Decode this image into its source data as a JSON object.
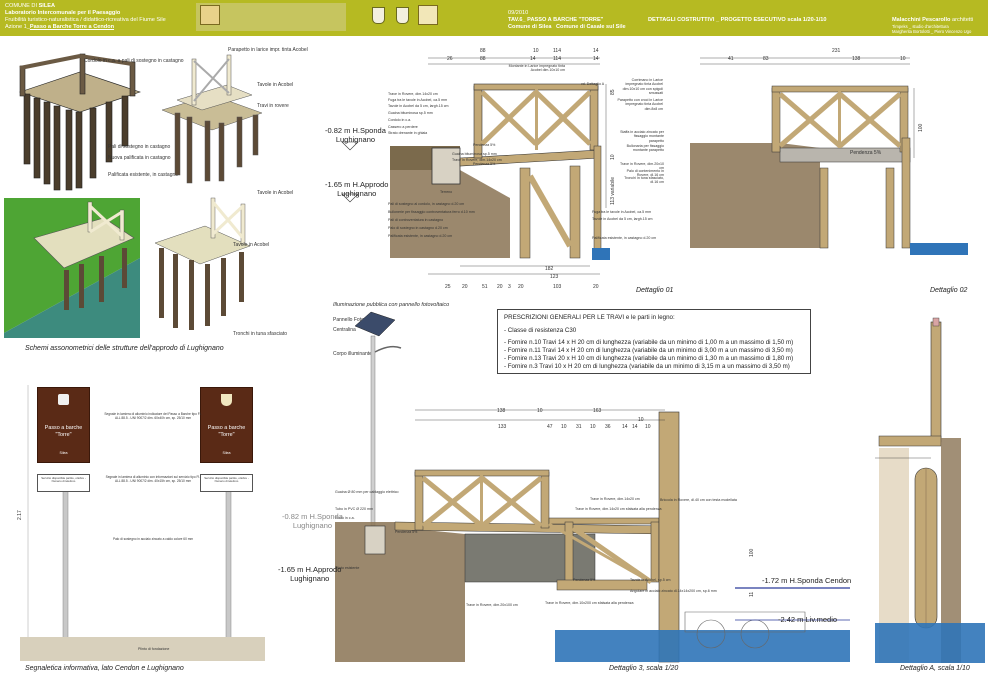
{
  "header": {
    "comune_prefix": "COMUNE DI",
    "comune_name": "SILEA",
    "lab": "Laboratorio Intercomunale per il Paesaggio",
    "fruibilita": "Fruibilità turistico-naturalistica / didattico-ricreativa del Fiume Sile",
    "azione_prefix": "Azione 1_",
    "azione_name": "Passo a Barche Torre a Cendon",
    "date": "09/2010",
    "tavola": "TAV.6_ PASSO A BARCHE \"TORRE\"",
    "comune1": "Comune di Silea",
    "comune2": "Comune di Casale sul Sile",
    "dettagli": "DETTAGLI COSTRUTTIVI _ PROGETTO ESECUTIVO scala 1/20-1/10",
    "architects": "Malacchini Pescarollo",
    "architects_suffix": "architetti",
    "team1": "Timpeks _ studio d'architettura",
    "team2": "Margherita Bortolotti _ Piero Vincenzo Ugo",
    "colors": {
      "band": "#b6ba22",
      "wood": "#c2a876",
      "water": "#2f74b8",
      "ground": "#7a6548"
    }
  },
  "captions": {
    "schemi": "Schemi assonometrici delle strutture dell'approdo di Lughignano",
    "segnaletica": "Segnaletica informativa, lato Cendon e Lughignano",
    "dettaglio01": "Dettaglio 01",
    "dettaglio02": "Dettaglio 02",
    "dettaglio3": "Dettaglio 3, scala 1/20",
    "dettaglioA": "Dettaglio A, scala 1/10"
  },
  "iso_labels": {
    "corrimano": "Cordolo in c.a. a pali di sostegno in castagno",
    "pali": "Pali di sostegno in castagno",
    "nuova": "Nuova palificata in castagno",
    "palificata": "Palificata esistente, in castagno",
    "parapetto": "Parapetto in larice impr. tinta Acobel",
    "tavole": "Tavole in Acobel",
    "travi": "Travi in rovere",
    "tavole2": "Tavole in Acobel",
    "tronchi": "Tronchi in tuna sfasciato"
  },
  "levels": {
    "sponda1": "-0.82 m H.Sponda",
    "sponda1b": "Lughignano",
    "approdo1": "-1.65 m H.Approdo",
    "approdo1b": "Lughignano",
    "sponda2": "-0.82 m H.Sponda",
    "sponda2b": "Lughignano",
    "approdo2": "-1.65 m H.Approdo",
    "approdo2b": "Lughignano",
    "cendon": "-1.72 m H.Sponda Cendon",
    "liv_medio": "-2.42 m Liv.medio"
  },
  "dims_d01": {
    "top": [
      "88",
      "10",
      "114",
      "14",
      "26",
      "88",
      "14",
      "114",
      "14"
    ],
    "bottom": [
      "182",
      "123",
      "25",
      "20",
      "51",
      "20",
      "3",
      "20",
      "103",
      "20"
    ],
    "side": [
      "85",
      "10",
      "113 variabile"
    ]
  },
  "dims_d02": {
    "top": [
      "231",
      "41",
      "83",
      "138",
      "10"
    ],
    "side": [
      "100"
    ]
  },
  "dims_d3": {
    "top": [
      "138",
      "10",
      "163",
      "10",
      "133",
      "47",
      "10",
      "31",
      "10",
      "36",
      "14",
      "14",
      "10"
    ],
    "side": [
      "100",
      "11"
    ]
  },
  "d01_labels": [
    "Montante in Larice impregnato tinta Acobel dim.10x10 cm",
    "vd. Dettaglio A",
    "Corrimano in Larice impregnato tinta Acobel dim.10x10 cm con spigoli smussati",
    "Parapetto con croci in Larice impregnato tinta Acobel dim.8x8 cm",
    "Staffa in acciaio zincato per fissaggio montante parapetto",
    "Bullonaria per fissaggio montante parapetto",
    "Trave in Rovere, dim.20x10 cm",
    "Palo di contenimento in Rovere, dl.16 cm",
    "Tronchi in tuna sfasciato, dl.16 cm",
    "Trave in Rovere, dim.14x20 cm",
    "Fuga tra le tavole in Acobel, ca.5 mm",
    "Tavole in Acobel da 5 cm, largh.15 cm",
    "Guaina bituminosa sp.5 mm",
    "Cordolo in c.a.",
    "Cassero a perdere",
    "Strato drenante in ghiaia",
    "Pendenza 5%",
    "Guaina bituminosa sp.5 mm",
    "Trave in Rovere, dim.14x20 cm",
    "Pendenza 5%",
    "Pali di sostegno al cordolo, in castagno d.20 cm",
    "Bullonerie per fissaggio controventatura ferro d.10 mm",
    "Pali di controventatura in castagno",
    "Palo di sostegno in castagno d.20 cm",
    "Palificata esistente, in castagno d.20 cm",
    "Fuga tra le tavole in Acobel, ca.5 mm",
    "Tavole in Acobel da 5 cm, largh.15 cm",
    "Terreno",
    "Palificata esistente, in castagno d.20 cm"
  ],
  "d02_labels": [
    "Pendenza 5%"
  ],
  "presc": {
    "title": "PRESCRIZIONI GENERALI PER LE TRAVI e le parti in legno:",
    "classe": "- Classe di resistenza C30",
    "r1": "- Fornire n.10 Travi 14 x H 20 cm  di lunghezza (variabile da un minimo di 1,00 m a un massimo di 1,50 m)",
    "r2": "- Fornire n.11 Travi 14 x H 20 cm  di lunghezza (variabile da un minimo di 3,00 m a un massimo di 3,50 m)",
    "r3": "- Fornire n.13 Travi 20 x H 10 cm  di lunghezza (variabile da un minimo di 1,30 m a un massimo di 1,80 m)",
    "r4": "- Fornire n.3   Travi 10 x H 20 cm  di lunghezza (variabile da un minimo di  3,15 m a un massimo di 3,50 m)"
  },
  "lamp": {
    "title": "Illuminazione pubblica con pannello fotovoltaico",
    "pannello": "Pannello Fotovoltaico",
    "centralina": "Centralina",
    "corpo": "Corpo illuminante"
  },
  "d3_labels": [
    "Guaina Ø 80 mm per cablaggio elettrico",
    "Tubo in PVC Ø 220 mm",
    "Plinto in c.a.",
    "Pendenza 5%",
    "Plinto esistente",
    "Briccola in Rovere, dl.40 cm con testa modellata",
    "Trave in Rovere, dim.14x20 cm",
    "Trave in Rovere, dim.14x20 cm sfalsata alla pendenza",
    "Pendenza 5%",
    "Tavole in Acobel, sp.5 cm",
    "Angolare in acciaio zincato dl.14x14x200 cm, sp.6 mm",
    "Trave in Rovere, dim.20x100 cm",
    "Trave in Rovere, dim.10x200 cm sfalsata alla pendenza"
  ],
  "sign": {
    "title1": "Passo a barche",
    "title2": "\"Torre\"",
    "small": "Silea",
    "plate": "Servizio disponibile partire, ottobre - Numero di telefono",
    "label1": "Segnale in lamiera di alluminio indicatore del Passo a Barche tipo FI-ALL 88.5 - UNI 9007/2 dim. 60x40h cm, sp. 25/10 mm",
    "label2": "Segnale in lamiera di alluminio con informazioni sul servizio tipo FI-ALL 88.5 - UNI 9007/2 dim. 40x15h cm, sp. 25/10 mm",
    "palo": "Palo di sostegno in acciaio zincato a caldo colore 60 mm",
    "plinto": "Plinto di fondazione",
    "height": "2.17"
  }
}
